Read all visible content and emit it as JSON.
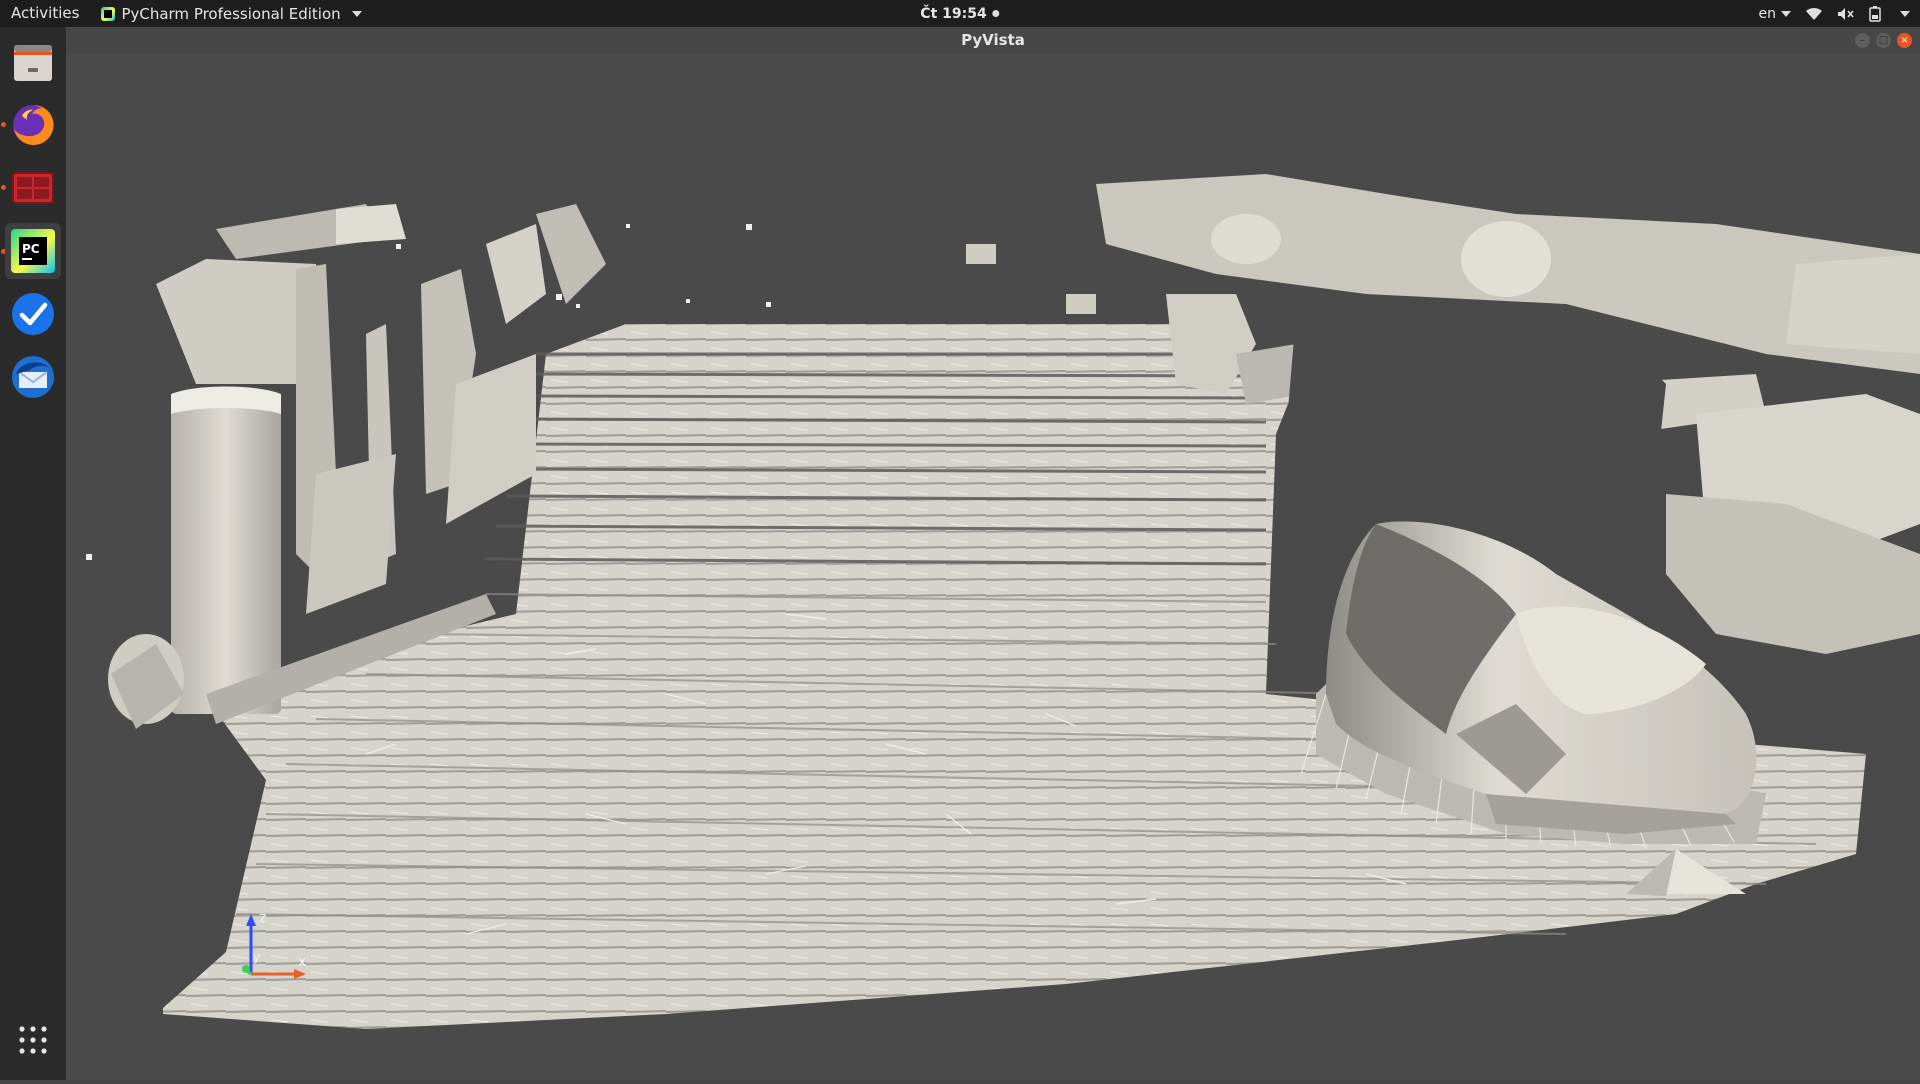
{
  "topbar": {
    "activities": "Activities",
    "app_menu": "PyCharm Professional Edition",
    "clock": "Čt 19:54",
    "language": "en"
  },
  "dock": {
    "items": [
      {
        "name": "files",
        "icon": "file-cabinet-icon"
      },
      {
        "name": "firefox",
        "icon": "firefox-icon",
        "running": true
      },
      {
        "name": "remote-desktop",
        "icon": "remote-desktop-icon",
        "running": true
      },
      {
        "name": "pycharm",
        "icon": "pycharm-icon",
        "running": true,
        "active": true
      },
      {
        "name": "tasks",
        "icon": "checkmark-icon"
      },
      {
        "name": "thunderbird",
        "icon": "thunderbird-icon"
      }
    ],
    "show_apps_icon": "app-grid-icon"
  },
  "window": {
    "title": "PyVista"
  },
  "viewport": {
    "background": "#4a4a4a",
    "mesh_color": "#d6d3cb",
    "axes": {
      "z": "z",
      "y": "y",
      "x": "x"
    }
  }
}
